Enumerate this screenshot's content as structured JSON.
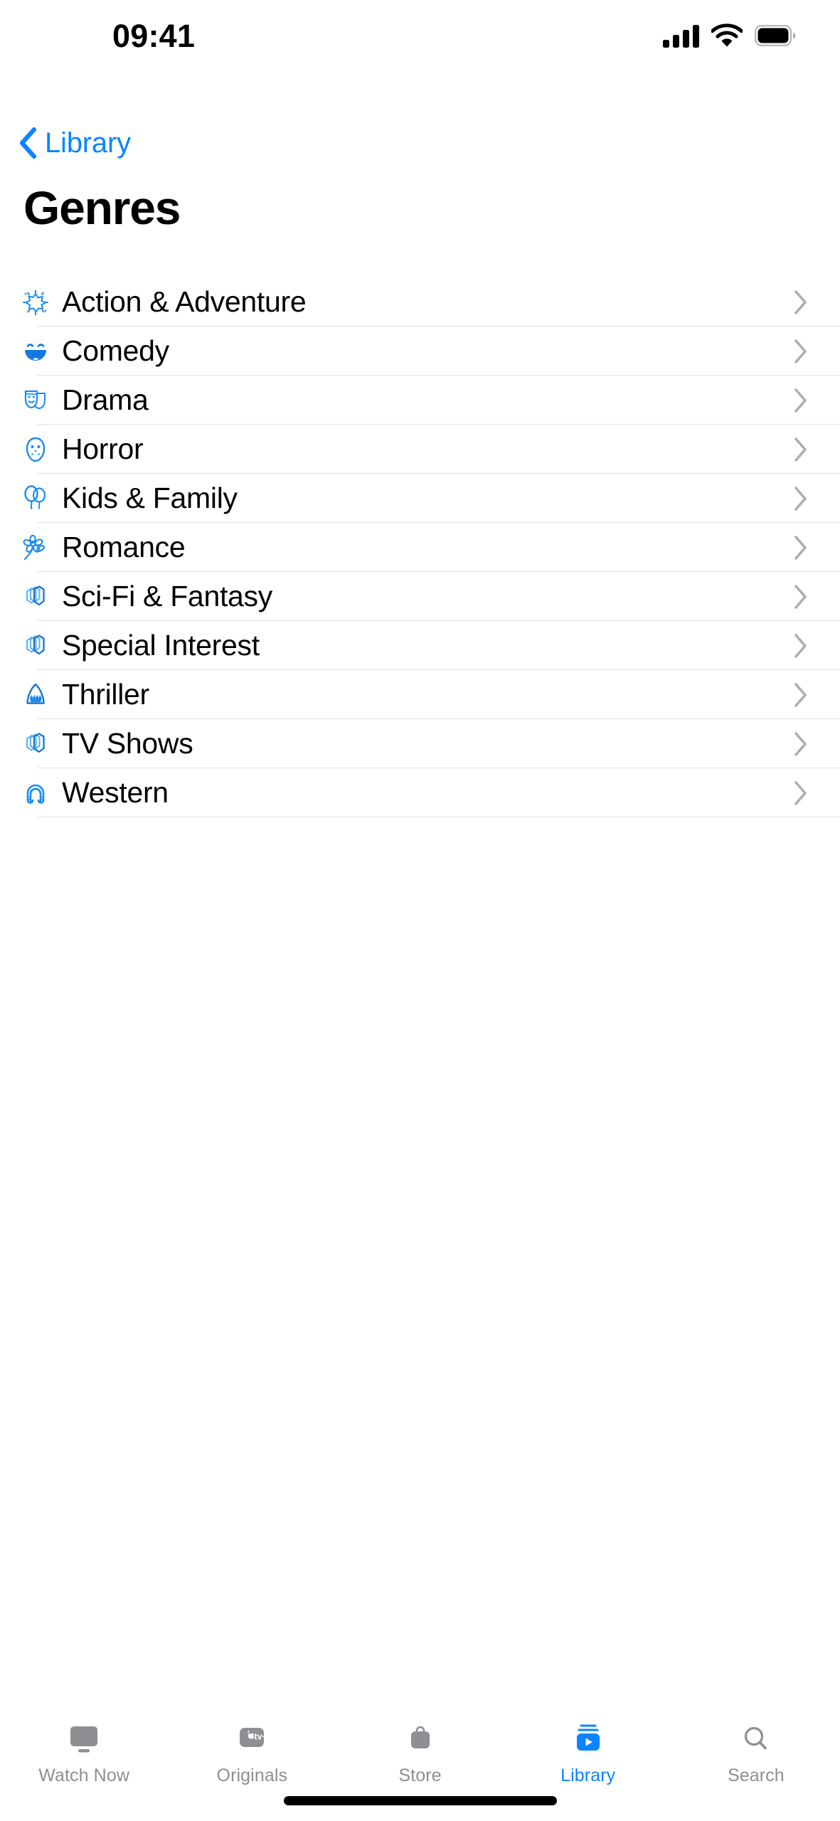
{
  "status_bar": {
    "time": "09:41",
    "icons": {
      "cellular": "signal-bars-icon",
      "wifi": "wifi-icon",
      "battery": "battery-full-icon"
    }
  },
  "nav": {
    "back_label": "Library",
    "back_icon": "chevron-left-icon"
  },
  "header": {
    "title": "Genres"
  },
  "list": {
    "disclosure_icon": "chevron-right-icon",
    "items": [
      {
        "label": "Action & Adventure",
        "icon": "burst-icon"
      },
      {
        "label": "Comedy",
        "icon": "laughing-face-icon"
      },
      {
        "label": "Drama",
        "icon": "theater-masks-icon"
      },
      {
        "label": "Horror",
        "icon": "hockey-mask-icon"
      },
      {
        "label": "Kids & Family",
        "icon": "balloons-icon"
      },
      {
        "label": "Romance",
        "icon": "flower-icon"
      },
      {
        "label": "Sci-Fi & Fantasy",
        "icon": "film-stack-icon"
      },
      {
        "label": "Special Interest",
        "icon": "film-stack-icon"
      },
      {
        "label": "Thriller",
        "icon": "shark-icon"
      },
      {
        "label": "TV Shows",
        "icon": "film-stack-icon"
      },
      {
        "label": "Western",
        "icon": "horseshoe-icon"
      }
    ]
  },
  "tab_bar": {
    "active": "Library",
    "tabs": [
      {
        "label": "Watch Now",
        "icon": "tv-monitor-icon"
      },
      {
        "label": "Originals",
        "icon": "apple-tv-plus-icon"
      },
      {
        "label": "Store",
        "icon": "shopping-bag-icon"
      },
      {
        "label": "Library",
        "icon": "library-play-stack-icon"
      },
      {
        "label": "Search",
        "icon": "magnifying-glass-icon"
      }
    ]
  },
  "colors": {
    "accent": "#0a84ff",
    "icon_blue": "#1c8ced",
    "inactive_gray": "#8e8e93",
    "separator": "#e3e3e5",
    "text": "#000000",
    "background": "#ffffff"
  }
}
